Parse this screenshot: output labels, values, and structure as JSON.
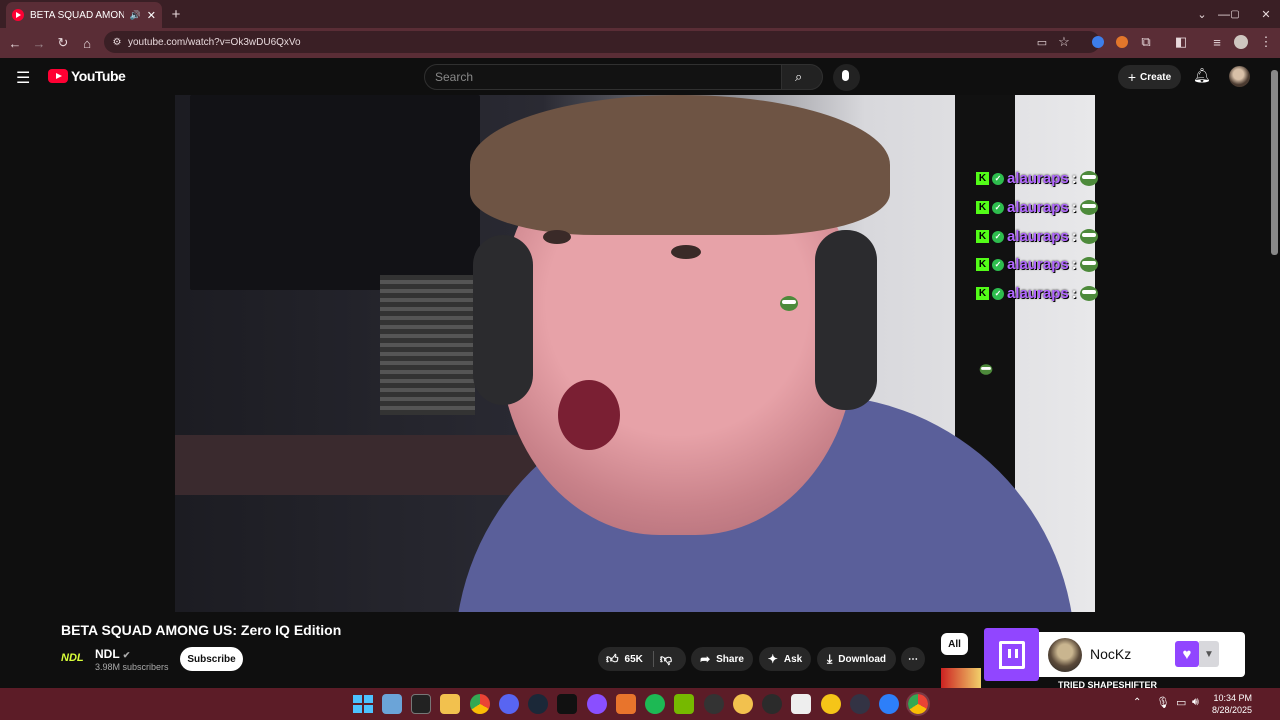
{
  "browser": {
    "tab_title": "BETA SQUAD AMONG US: Z",
    "url": "youtube.com/watch?v=Ok3wDU6QxVo"
  },
  "youtube": {
    "logo_text": "YouTube",
    "search_placeholder": "Search",
    "create_label": "Create"
  },
  "overlay": {
    "chat_user": "alauraps",
    "chat_separator": ":",
    "chat_lines": 5
  },
  "video_info": {
    "title": "BETA SQUAD AMONG US: Zero IQ Edition",
    "channel": "NDL",
    "channel_logo_text": "NDL",
    "subscribers": "3.98M subscribers",
    "subscribe_label": "Subscribe",
    "likes": "65K",
    "share_label": "Share",
    "ask_label": "Ask",
    "download_label": "Download"
  },
  "sidebar": {
    "chip_all": "All",
    "recommend_snippet": "TRIED SHAPESHIFTER"
  },
  "twitch_popup": {
    "streamer": "NocKz"
  },
  "taskbar": {
    "time": "10:34 PM",
    "date": "8/28/2025"
  },
  "colors": {
    "tab_bar": "#3a1f25",
    "toolbar": "#5a2d36",
    "youtube_red": "#ff0033",
    "twitch_purple": "#9146ff",
    "kick_green": "#53fc18",
    "chat_name": "#b166ff",
    "taskbar": "#5c1c27"
  }
}
